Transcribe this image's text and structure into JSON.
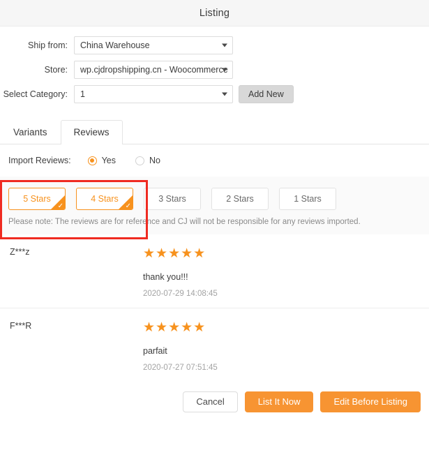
{
  "header": {
    "title": "Listing"
  },
  "colors": {
    "accent": "#f7921e",
    "primary_button": "#f79432",
    "annotation": "#ef2b21",
    "header_bg": "#f6f6f6",
    "filter_bg": "#fafafa"
  },
  "form": {
    "rows": [
      {
        "label": "Ship from:",
        "value": "China Warehouse",
        "has_add_button": false
      },
      {
        "label": "Store:",
        "value": "wp.cjdropshipping.cn - Woocommerce",
        "has_add_button": false
      },
      {
        "label": "Select Category:",
        "value": "1",
        "has_add_button": true
      }
    ],
    "add_new_label": "Add New"
  },
  "tabs": [
    {
      "label": "Variants",
      "active": false
    },
    {
      "label": "Reviews",
      "active": true
    }
  ],
  "import_reviews": {
    "label": "Import Reviews:",
    "options": [
      {
        "label": "Yes",
        "checked": true
      },
      {
        "label": "No",
        "checked": false
      }
    ]
  },
  "star_filter": {
    "buttons": [
      {
        "label": "5 Stars",
        "selected": true
      },
      {
        "label": "4 Stars",
        "selected": true
      },
      {
        "label": "3 Stars",
        "selected": false
      },
      {
        "label": "2 Stars",
        "selected": false
      },
      {
        "label": "1 Stars",
        "selected": false
      }
    ],
    "note": "Please note: The reviews are for reference and CJ will not be responsible for any reviews imported.",
    "check_glyph": "✓"
  },
  "reviews": [
    {
      "user": "Z***z",
      "rating": 5,
      "stars": "★★★★★",
      "text": "thank you!!!",
      "date": "2020-07-29 14:08:45"
    },
    {
      "user": "F***R",
      "rating": 5,
      "stars": "★★★★★",
      "text": "parfait",
      "date": "2020-07-27 07:51:45"
    }
  ],
  "footer": {
    "cancel_label": "Cancel",
    "list_now_label": "List It Now",
    "edit_before_label": "Edit Before Listing"
  }
}
